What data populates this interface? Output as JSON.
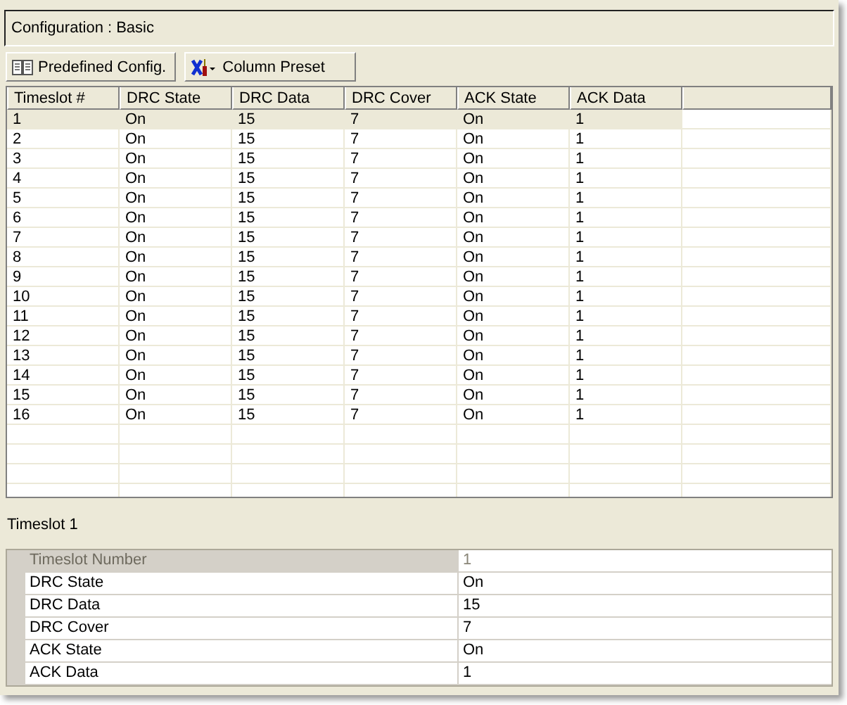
{
  "config_label": "Configuration : Basic",
  "toolbar": [
    {
      "label": "Predefined Config.",
      "kind": "book"
    },
    {
      "label": "Column Preset",
      "kind": "tools"
    }
  ],
  "table": {
    "columns": [
      "Timeslot #",
      "DRC State",
      "DRC Data",
      "DRC Cover",
      "ACK State",
      "ACK Data"
    ],
    "rows": [
      {
        "cells": [
          "1",
          "On",
          "15",
          "7",
          "On",
          "1"
        ],
        "selected": true
      },
      {
        "cells": [
          "2",
          "On",
          "15",
          "7",
          "On",
          "1"
        ],
        "selected": false
      },
      {
        "cells": [
          "3",
          "On",
          "15",
          "7",
          "On",
          "1"
        ],
        "selected": false
      },
      {
        "cells": [
          "4",
          "On",
          "15",
          "7",
          "On",
          "1"
        ],
        "selected": false
      },
      {
        "cells": [
          "5",
          "On",
          "15",
          "7",
          "On",
          "1"
        ],
        "selected": false
      },
      {
        "cells": [
          "6",
          "On",
          "15",
          "7",
          "On",
          "1"
        ],
        "selected": false
      },
      {
        "cells": [
          "7",
          "On",
          "15",
          "7",
          "On",
          "1"
        ],
        "selected": false
      },
      {
        "cells": [
          "8",
          "On",
          "15",
          "7",
          "On",
          "1"
        ],
        "selected": false
      },
      {
        "cells": [
          "9",
          "On",
          "15",
          "7",
          "On",
          "1"
        ],
        "selected": false
      },
      {
        "cells": [
          "10",
          "On",
          "15",
          "7",
          "On",
          "1"
        ],
        "selected": false
      },
      {
        "cells": [
          "11",
          "On",
          "15",
          "7",
          "On",
          "1"
        ],
        "selected": false
      },
      {
        "cells": [
          "12",
          "On",
          "15",
          "7",
          "On",
          "1"
        ],
        "selected": false
      },
      {
        "cells": [
          "13",
          "On",
          "15",
          "7",
          "On",
          "1"
        ],
        "selected": false
      },
      {
        "cells": [
          "14",
          "On",
          "15",
          "7",
          "On",
          "1"
        ],
        "selected": false
      },
      {
        "cells": [
          "15",
          "On",
          "15",
          "7",
          "On",
          "1"
        ],
        "selected": false
      },
      {
        "cells": [
          "16",
          "On",
          "15",
          "7",
          "On",
          "1"
        ],
        "selected": false
      }
    ]
  },
  "details": {
    "title": "Timeslot 1",
    "properties": [
      {
        "name": "Timeslot Number",
        "value": "1",
        "disabled": true
      },
      {
        "name": "DRC State",
        "value": "On",
        "disabled": false
      },
      {
        "name": "DRC Data",
        "value": "15",
        "disabled": false
      },
      {
        "name": "DRC Cover",
        "value": "7",
        "disabled": false
      },
      {
        "name": "ACK State",
        "value": "On",
        "disabled": false
      },
      {
        "name": "ACK Data",
        "value": "1",
        "disabled": false
      }
    ]
  }
}
